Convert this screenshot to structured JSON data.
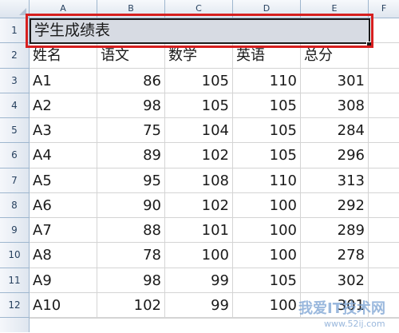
{
  "spreadsheet": {
    "columns": [
      "A",
      "B",
      "C",
      "D",
      "E",
      "F"
    ],
    "row_numbers": [
      "1",
      "2",
      "3",
      "4",
      "5",
      "6",
      "7",
      "8",
      "9",
      "10",
      "11",
      "12"
    ],
    "title": "学生成绩表",
    "headers": [
      "姓名",
      "语文",
      "数学",
      "英语",
      "总分"
    ],
    "rows": [
      [
        "A1",
        "86",
        "105",
        "110",
        "301"
      ],
      [
        "A2",
        "98",
        "105",
        "105",
        "308"
      ],
      [
        "A3",
        "75",
        "104",
        "105",
        "284"
      ],
      [
        "A4",
        "89",
        "102",
        "105",
        "296"
      ],
      [
        "A5",
        "95",
        "108",
        "110",
        "313"
      ],
      [
        "A6",
        "90",
        "102",
        "100",
        "292"
      ],
      [
        "A7",
        "88",
        "101",
        "100",
        "289"
      ],
      [
        "A8",
        "78",
        "100",
        "100",
        "278"
      ],
      [
        "A9",
        "98",
        "99",
        "105",
        "302"
      ],
      [
        "A10",
        "102",
        "99",
        "100",
        "301"
      ]
    ]
  },
  "watermark": {
    "text": "我爱IT技术网",
    "url": "www.52ij.com"
  },
  "colors": {
    "highlight_border": "#d61f1f",
    "title_fill": "#d7dbe3",
    "header_border": "#9eb6ce"
  }
}
